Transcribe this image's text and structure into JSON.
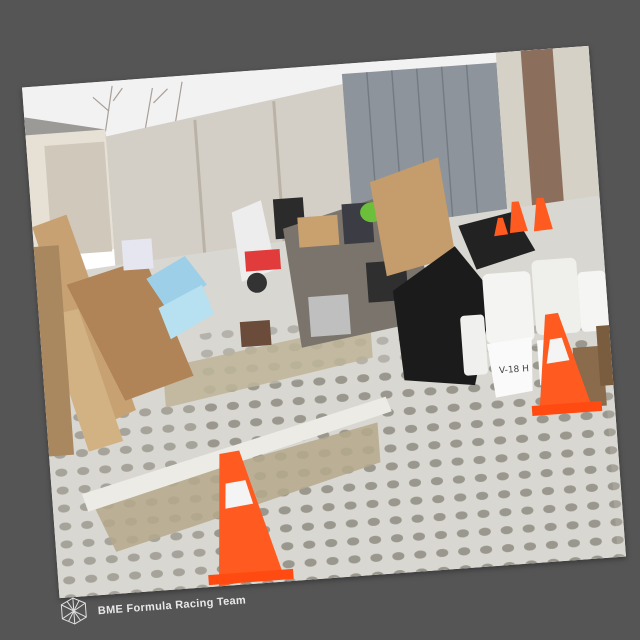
{
  "footer": {
    "team_name": "BME Formula Racing Team",
    "logo_icon": "cube-wireframe-icon"
  },
  "photo": {
    "container_label": "V-18 H"
  },
  "colors": {
    "background": "#555555",
    "cone_orange": "#ff5a1f",
    "cone_stripe": "#f4f4f4",
    "paver_light": "#dcdcd6",
    "wall": "#d4cfc6",
    "garage_door": "#8d949b"
  }
}
